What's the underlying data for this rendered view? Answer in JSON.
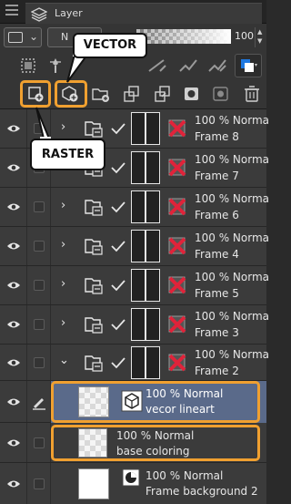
{
  "panel": {
    "tab_title": "Layer",
    "blend_mode": "N",
    "opacity_value": "100",
    "opacity_fraction": 1.0,
    "icons": {
      "tab": "layers-icon",
      "blend_thumb": "layer-property-icon",
      "toolbar1": [
        "mask-icon",
        "reference-layer-icon",
        "clip-icon",
        "ruler-icon",
        "color-icon",
        "layer-color-icon"
      ],
      "toolbar2": [
        "new-raster-layer-icon",
        "new-vector-layer-icon",
        "new-folder-icon",
        "transfer-to-lower-icon",
        "combine-icon",
        "mask-layer-icon",
        "apply-mask-icon",
        "delete-layer-icon"
      ]
    }
  },
  "callouts": {
    "vector": "VECTOR",
    "raster": "RASTER"
  },
  "layers": [
    {
      "kind": "folder",
      "line1": "100 % Norma",
      "line2": "Frame 8",
      "expanded": false
    },
    {
      "kind": "folder",
      "line1": "100 % Norma",
      "line2": "Frame 7",
      "expanded": false
    },
    {
      "kind": "folder",
      "line1": "100 % Norma",
      "line2": "Frame 6",
      "expanded": false
    },
    {
      "kind": "folder",
      "line1": "100 % Norma",
      "line2": "Frame 4",
      "expanded": false
    },
    {
      "kind": "folder",
      "line1": "100 % Norma",
      "line2": "Frame 5",
      "expanded": false
    },
    {
      "kind": "folder",
      "line1": "100 % Norma",
      "line2": "Frame 3",
      "expanded": false
    },
    {
      "kind": "folder",
      "line1": "100 % Norma",
      "line2": "Frame 2",
      "expanded": true
    },
    {
      "kind": "vector",
      "line1": "100 % Normal",
      "line2": "vecor lineart",
      "selected": true
    },
    {
      "kind": "raster",
      "line1": "100 % Normal",
      "line2": "base coloring"
    },
    {
      "kind": "paper",
      "line1": "100 % Normal",
      "line2": "Frame background 2"
    }
  ],
  "colors": {
    "highlight": "#f0a030",
    "selected_row": "#5a6a8a",
    "panel_bg": "#3b3b3b",
    "red_x": "#e0233a"
  }
}
